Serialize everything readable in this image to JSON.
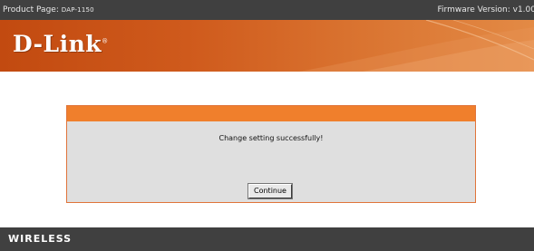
{
  "topbar": {
    "product_label": "Product Page:",
    "product_model": "DAP-1150",
    "firmware_label": "Firmware Version: v1.00"
  },
  "banner": {
    "logo_text": "D-Link",
    "logo_registered": "®"
  },
  "dialog": {
    "message": "Change setting successfully!",
    "continue_label": "Continue"
  },
  "footer": {
    "brand_text": "WIRELESS"
  },
  "colors": {
    "topbar_bg": "#404040",
    "banner_orange": "#cf5a1c",
    "dialog_header": "#f07f2c",
    "dialog_bg": "#dfdfdf"
  }
}
